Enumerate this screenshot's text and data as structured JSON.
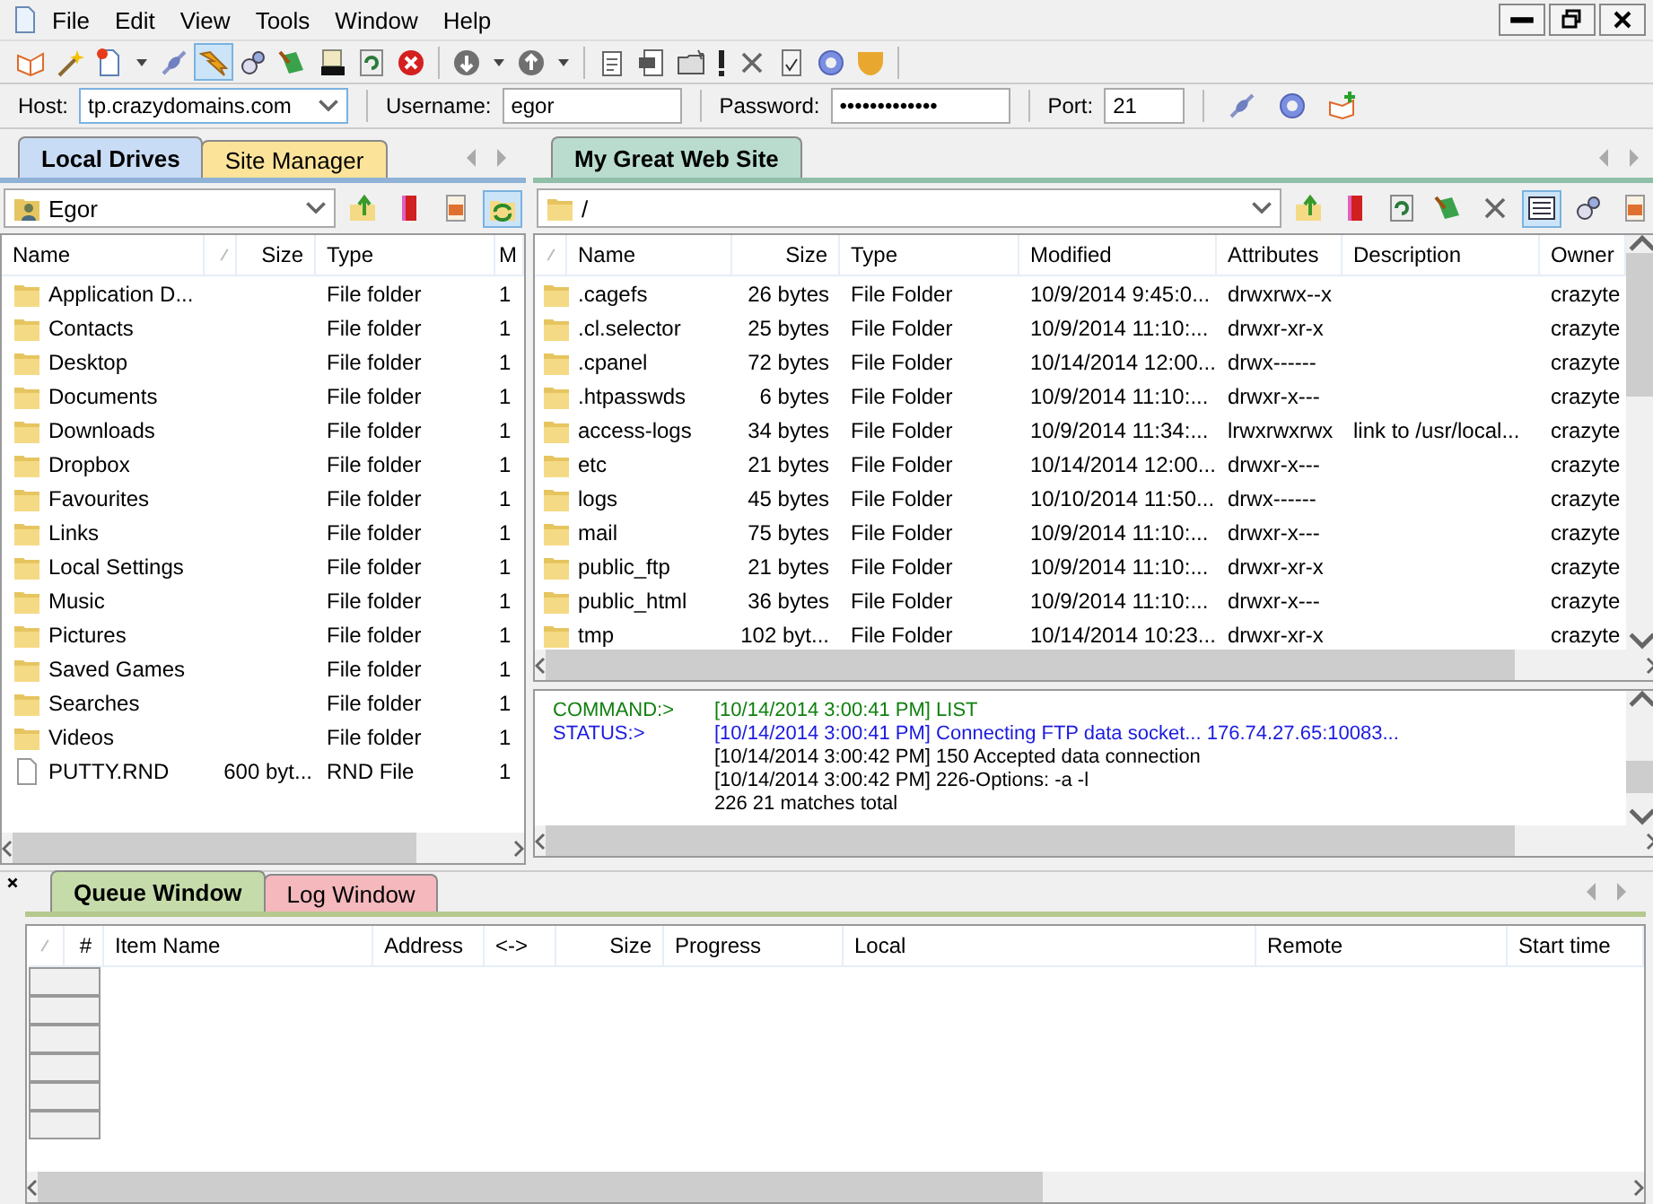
{
  "menu": [
    {
      "label": "File"
    },
    {
      "label": "Edit"
    },
    {
      "label": "View"
    },
    {
      "label": "Tools"
    },
    {
      "label": "Window"
    },
    {
      "label": "Help"
    }
  ],
  "toolbar": {
    "buttons": [
      {
        "selected": false
      },
      {
        "selected": false
      },
      {
        "selected": false
      },
      {
        "selected": false
      },
      {
        "selected": false
      },
      {
        "selected": true
      },
      {
        "selected": false
      },
      {
        "selected": false
      },
      {
        "selected": false
      },
      {
        "selected": false
      },
      {
        "selected": false
      },
      {
        "selected": false
      },
      {
        "selected": false
      },
      {
        "selected": false
      },
      {
        "selected": false
      },
      {
        "selected": false
      },
      {
        "selected": false
      },
      {
        "selected": false
      },
      {
        "selected": false
      },
      {
        "selected": false
      },
      {
        "selected": false
      },
      {
        "selected": false
      },
      {
        "selected": false
      }
    ]
  },
  "connection": {
    "host_label": "Host:",
    "host": "tp.crazydomains.com",
    "username_label": "Username:",
    "username": "egor",
    "password_label": "Password:",
    "password": "•••••••••••••",
    "port_label": "Port:",
    "port": "21"
  },
  "local": {
    "tabs": [
      {
        "label": "Local Drives",
        "selected": true,
        "color": "#c9dcf5"
      },
      {
        "label": "Site Manager",
        "selected": false,
        "color": "#fbe39a"
      }
    ],
    "path": "Egor",
    "tools": [
      {
        "selected": false
      },
      {
        "selected": false
      },
      {
        "selected": false
      },
      {
        "selected": true
      }
    ],
    "columns": [
      "Name",
      "Size",
      "Type",
      "M"
    ],
    "rows": [
      {
        "kind": "folder",
        "name": "Application D...",
        "type": "File folder",
        "column_4": "1"
      },
      {
        "kind": "folder",
        "name": "Contacts",
        "type": "File folder",
        "column_4": "1"
      },
      {
        "kind": "folder",
        "name": "Desktop",
        "type": "File folder",
        "column_4": "1"
      },
      {
        "kind": "folder",
        "name": "Documents",
        "type": "File folder",
        "column_4": "1"
      },
      {
        "kind": "folder",
        "name": "Downloads",
        "type": "File folder",
        "column_4": "1"
      },
      {
        "kind": "folder",
        "name": "Dropbox",
        "type": "File folder",
        "column_4": "1"
      },
      {
        "kind": "folder",
        "name": "Favourites",
        "type": "File folder",
        "column_4": "1"
      },
      {
        "kind": "folder",
        "name": "Links",
        "type": "File folder",
        "column_4": "1"
      },
      {
        "kind": "folder",
        "name": "Local Settings",
        "type": "File folder",
        "column_4": "1"
      },
      {
        "kind": "folder",
        "name": "Music",
        "type": "File folder",
        "column_4": "1"
      },
      {
        "kind": "folder",
        "name": "Pictures",
        "type": "File folder",
        "column_4": "1"
      },
      {
        "kind": "folder",
        "name": "Saved Games",
        "type": "File folder",
        "column_4": "1"
      },
      {
        "kind": "folder",
        "name": "Searches",
        "type": "File folder",
        "column_4": "1"
      },
      {
        "kind": "folder",
        "name": "Videos",
        "type": "File folder",
        "column_4": "1"
      },
      {
        "kind": "file",
        "name": "PUTTY.RND",
        "size": "600 byt...",
        "type": "RND File",
        "column_4": "1"
      }
    ]
  },
  "remote": {
    "tabs": [
      {
        "label": "My Great Web Site",
        "selected": true,
        "color": "#b9dccf"
      }
    ],
    "path": "/",
    "tools": [
      {
        "selected": false
      },
      {
        "selected": false
      },
      {
        "selected": false
      },
      {
        "selected": false
      },
      {
        "selected": false
      },
      {
        "selected": true
      },
      {
        "selected": false
      },
      {
        "selected": false
      }
    ],
    "columns": [
      "Name",
      "Size",
      "Type",
      "Modified",
      "Attributes",
      "Description",
      "Owner"
    ],
    "rows": [
      {
        "kind": "folder",
        "name": ".cagefs",
        "size": "26 bytes",
        "type": "File Folder",
        "modified": "10/9/2014 9:45:0...",
        "attributes": "drwxrwx--x",
        "owner": "crazyte"
      },
      {
        "kind": "folder",
        "name": ".cl.selector",
        "size": "25 bytes",
        "type": "File Folder",
        "modified": "10/9/2014 11:10:...",
        "attributes": "drwxr-xr-x",
        "owner": "crazyte"
      },
      {
        "kind": "folder",
        "name": ".cpanel",
        "size": "72 bytes",
        "type": "File Folder",
        "modified": "10/14/2014 12:00...",
        "attributes": "drwx------",
        "owner": "crazyte"
      },
      {
        "kind": "folder",
        "name": ".htpasswds",
        "size": "6 bytes",
        "type": "File Folder",
        "modified": "10/9/2014 11:10:...",
        "attributes": "drwxr-x---",
        "owner": "crazyte"
      },
      {
        "kind": "folder",
        "name": "access-logs",
        "size": "34 bytes",
        "type": "File Folder",
        "modified": "10/9/2014 11:34:...",
        "attributes": "lrwxrwxrwx",
        "description": "link to /usr/local...",
        "owner": "crazyte"
      },
      {
        "kind": "folder",
        "name": "etc",
        "size": "21 bytes",
        "type": "File Folder",
        "modified": "10/14/2014 12:00...",
        "attributes": "drwxr-x---",
        "owner": "crazyte"
      },
      {
        "kind": "folder",
        "name": "logs",
        "size": "45 bytes",
        "type": "File Folder",
        "modified": "10/10/2014 11:50...",
        "attributes": "drwx------",
        "owner": "crazyte"
      },
      {
        "kind": "folder",
        "name": "mail",
        "size": "75 bytes",
        "type": "File Folder",
        "modified": "10/9/2014 11:10:...",
        "attributes": "drwxr-x---",
        "owner": "crazyte"
      },
      {
        "kind": "folder",
        "name": "public_ftp",
        "size": "21 bytes",
        "type": "File Folder",
        "modified": "10/9/2014 11:10:...",
        "attributes": "drwxr-xr-x",
        "owner": "crazyte"
      },
      {
        "kind": "folder",
        "name": "public_html",
        "size": "36 bytes",
        "type": "File Folder",
        "modified": "10/9/2014 11:10:...",
        "attributes": "drwxr-x---",
        "owner": "crazyte"
      },
      {
        "kind": "folder",
        "name": "tmp",
        "size": "102 byt...",
        "type": "File Folder",
        "modified": "10/14/2014 10:23...",
        "attributes": "drwxr-xr-x",
        "owner": "crazyte"
      }
    ]
  },
  "log": [
    {
      "kind": "command",
      "label": "COMMAND:>",
      "text": "[10/14/2014 3:00:41 PM] LIST"
    },
    {
      "kind": "status",
      "label": "STATUS:>",
      "text": "[10/14/2014 3:00:41 PM] Connecting FTP data socket... 176.74.27.65:10083..."
    },
    {
      "kind": "reply",
      "text": "[10/14/2014 3:00:42 PM] 150 Accepted data connection"
    },
    {
      "kind": "reply",
      "text": "[10/14/2014 3:00:42 PM] 226-Options: -a -l"
    },
    {
      "kind": "reply",
      "text": "226 21 matches total"
    }
  ],
  "queue": {
    "tabs": [
      {
        "label": "Queue Window",
        "selected": true,
        "color": "#c5dcaa"
      },
      {
        "label": "Log Window",
        "selected": false,
        "color": "#f4b8bd"
      }
    ],
    "columns": [
      "#",
      "Item Name",
      "Address",
      "<->",
      "Size",
      "Progress",
      "Local",
      "Remote",
      "Start time"
    ]
  }
}
